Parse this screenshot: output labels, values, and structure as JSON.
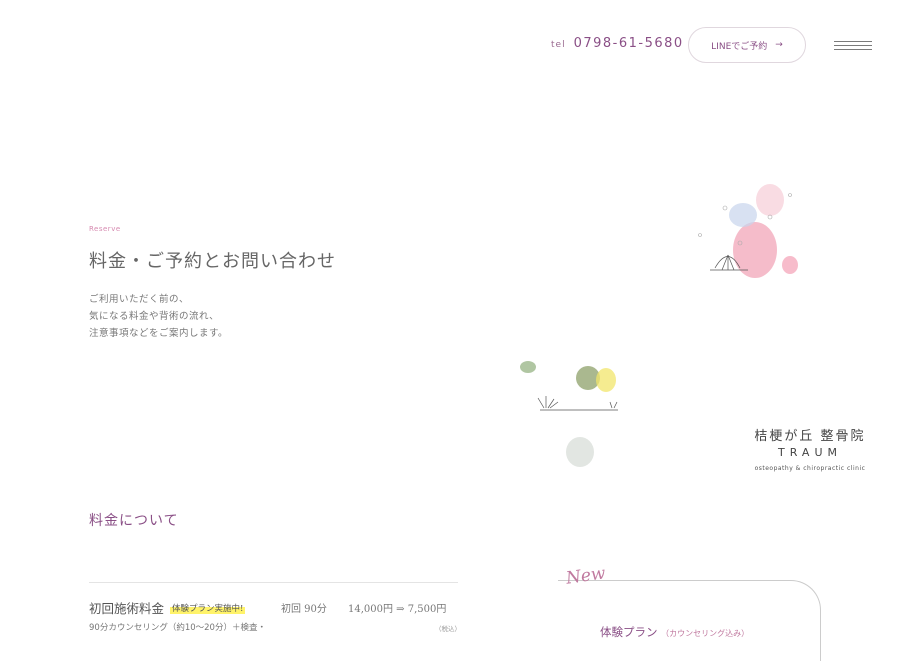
{
  "header": {
    "tel_label": "tel",
    "tel_number": "0798-61-5680",
    "line_button": "LINEでご予約",
    "line_arrow": "→",
    "menu_icon": "hamburger-menu-icon"
  },
  "hero": {
    "eyebrow": "Reserve",
    "title": "料金・ご予約とお問い合わせ",
    "intro": [
      "ご利用いただく前の、",
      "気になる料金や背術の流れ、",
      "注意事項などをご案内します。"
    ]
  },
  "logo": {
    "name_ja": "桔梗が丘 整骨院",
    "name_en": "TRAUM",
    "subtitle": "osteopathy & chiropractic clinic"
  },
  "pricing": {
    "section_title": "料金について",
    "items": [
      {
        "name": "初回施術料金",
        "badge": "体験プラン実施中!",
        "visit": "初回 90分",
        "price": "14,000円 ⇒ 7,500円",
        "desc": "90分カウンセリング（約10〜20分）＋検査・",
        "tax": "（税込）"
      }
    ]
  },
  "plan_card": {
    "new_label": "New",
    "title": "体験プラン",
    "note": "（カウンセリング込み）"
  },
  "colors": {
    "accent": "#8a4f86",
    "pink": "#d68ab0",
    "highlight": "#fff36a"
  }
}
